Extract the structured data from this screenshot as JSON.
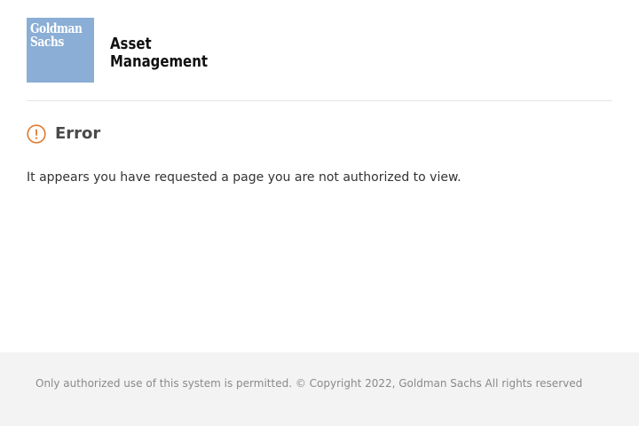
{
  "header": {
    "logo": {
      "line1": "Goldman",
      "line2": "Sachs",
      "color": "#8aaed5"
    },
    "division": {
      "line1": "Asset",
      "line2": "Management"
    }
  },
  "error": {
    "icon": "exclamation-circle-icon",
    "icon_color": "#e07a2e",
    "title": "Error",
    "message": "It appears you have requested a page you are not authorized to view."
  },
  "footer": {
    "text": "Only authorized use of this system is permitted. © Copyright 2022, Goldman Sachs All rights reserved"
  }
}
